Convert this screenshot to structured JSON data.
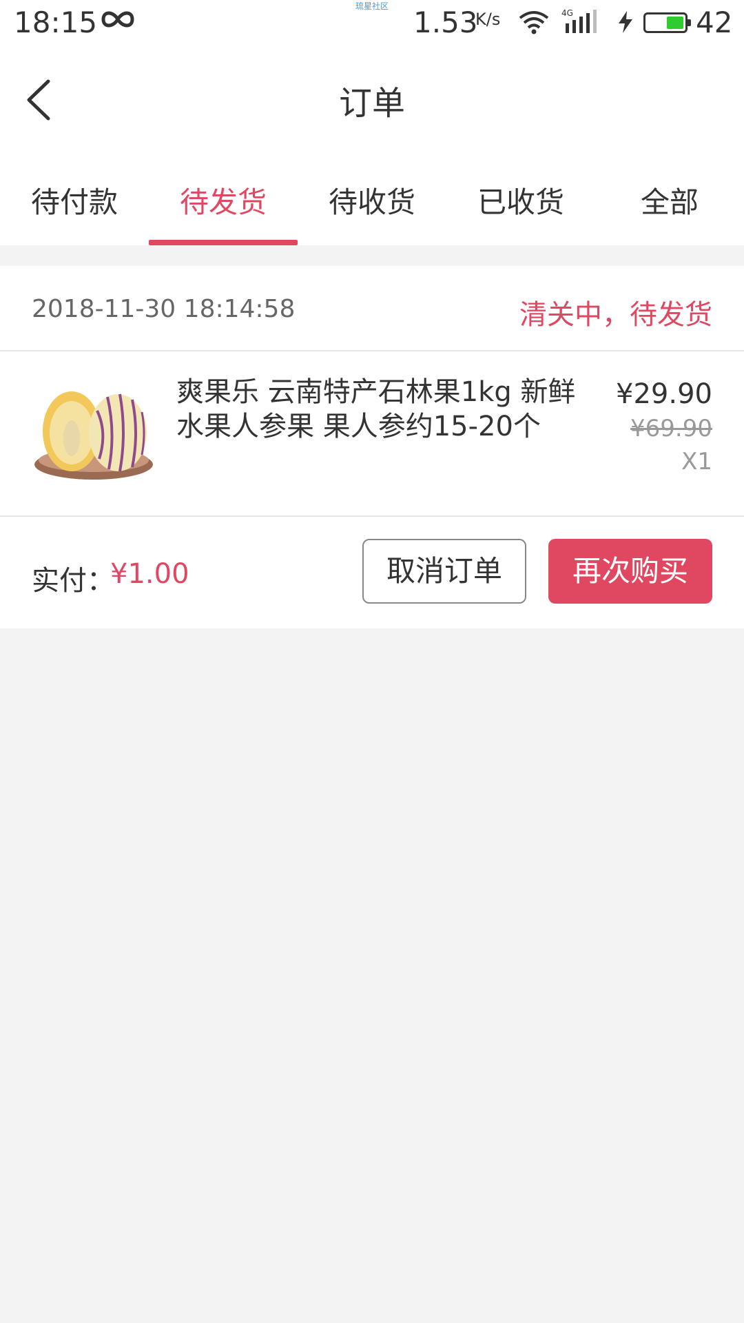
{
  "status_bar": {
    "time": "18:15",
    "carrier_text": "琉星社区",
    "speed": "1.53",
    "speed_unit": "K/s",
    "network": "4G",
    "battery_level": "42",
    "battery_fill": 0.42,
    "colors": {
      "battery": "#2ecc2e",
      "carrier": "#4a9be0"
    }
  },
  "header": {
    "title": "订单",
    "back_icon": "chevron-left-icon"
  },
  "tabs": [
    {
      "label": "待付款",
      "active": false
    },
    {
      "label": "待发货",
      "active": true
    },
    {
      "label": "待收货",
      "active": false
    },
    {
      "label": "已收货",
      "active": false
    },
    {
      "label": "全部",
      "active": false
    }
  ],
  "order": {
    "time": "2018-11-30 18:14:58",
    "status": "清关中，待发货",
    "item": {
      "name": "爽果乐 云南特产石林果1kg 新鲜水果人参果 果人参约15-20个",
      "price": "¥29.90",
      "original_price": "¥69.90",
      "quantity": "X1"
    },
    "paid_label": "实付：",
    "paid_amount": "¥1.00",
    "cancel_label": "取消订单",
    "rebuy_label": "再次购买"
  },
  "colors": {
    "accent": "#e04862",
    "background": "#f3f3f3",
    "text": "#333333",
    "muted": "#999999"
  }
}
